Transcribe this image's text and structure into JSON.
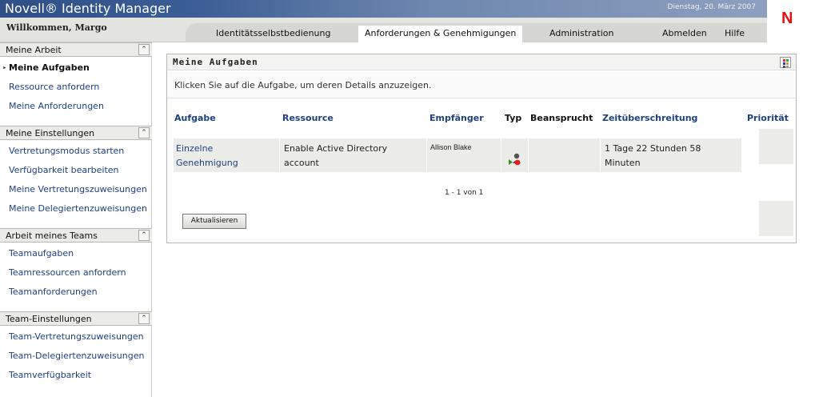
{
  "app": {
    "title": "Novell® Identity Manager",
    "date": "Dienstag, 20. März 2007",
    "logo_letter": "N",
    "brand_color": "#e8100f"
  },
  "header": {
    "welcome": "Willkommen, Margo",
    "tabs": [
      {
        "label": "Identitätsselbstbedienung"
      },
      {
        "label": "Anforderungen & Genehmigungen"
      },
      {
        "label": "Administration"
      },
      {
        "label": "Abmelden"
      },
      {
        "label": "Hilfe"
      }
    ],
    "active_tab": "Anforderungen & Genehmigungen"
  },
  "sidebar": {
    "sections": [
      {
        "title": "Meine Arbeit",
        "items": [
          {
            "label": "Meine Aufgaben"
          },
          {
            "label": "Ressource anfordern"
          },
          {
            "label": "Meine Anforderungen"
          }
        ]
      },
      {
        "title": "Meine Einstellungen",
        "items": [
          {
            "label": "Vertretungsmodus starten"
          },
          {
            "label": "Verfügbarkeit bearbeiten"
          },
          {
            "label": "Meine Vertretungszuweisungen"
          },
          {
            "label": "Meine Delegiertenzuweisungen"
          }
        ]
      },
      {
        "title": "Arbeit meines Teams",
        "items": [
          {
            "label": "Teamaufgaben"
          },
          {
            "label": "Teamressourcen anfordern"
          },
          {
            "label": "Teamanforderungen"
          }
        ]
      },
      {
        "title": "Team-Einstellungen",
        "items": [
          {
            "label": "Team-Vertretungszuweisungen"
          },
          {
            "label": "Team-Delegiertenzuweisungen"
          },
          {
            "label": "Teamverfügbarkeit"
          }
        ]
      }
    ],
    "current_item": "Meine Aufgaben",
    "collapse_icon": "double-chevron-up-icon"
  },
  "panel": {
    "title": "Meine Aufgaben",
    "info": "Klicken Sie auf die Aufgabe, um deren Details anzuzeigen.",
    "columns": {
      "task": "Aufgabe",
      "resource": "Ressource",
      "recipient": "Empfänger",
      "type": "Typ",
      "claimed": "Beansprucht",
      "timeout": "Zeitüberschreitung",
      "priority": "Priorität"
    },
    "rows": [
      {
        "task_line1": "Einzelne",
        "task_line2": "Genehmigung",
        "resource_line1": "Enable Active Directory",
        "resource_line2": "account",
        "recipient": "Allison Blake",
        "type_icon": "approval-user-icon",
        "claimed": "",
        "timeout_line1": "1 Tage 22 Stunden 58",
        "timeout_line2": "Minuten"
      }
    ],
    "pager": "1 - 1 von 1",
    "refresh_label": "Aktualisieren"
  }
}
